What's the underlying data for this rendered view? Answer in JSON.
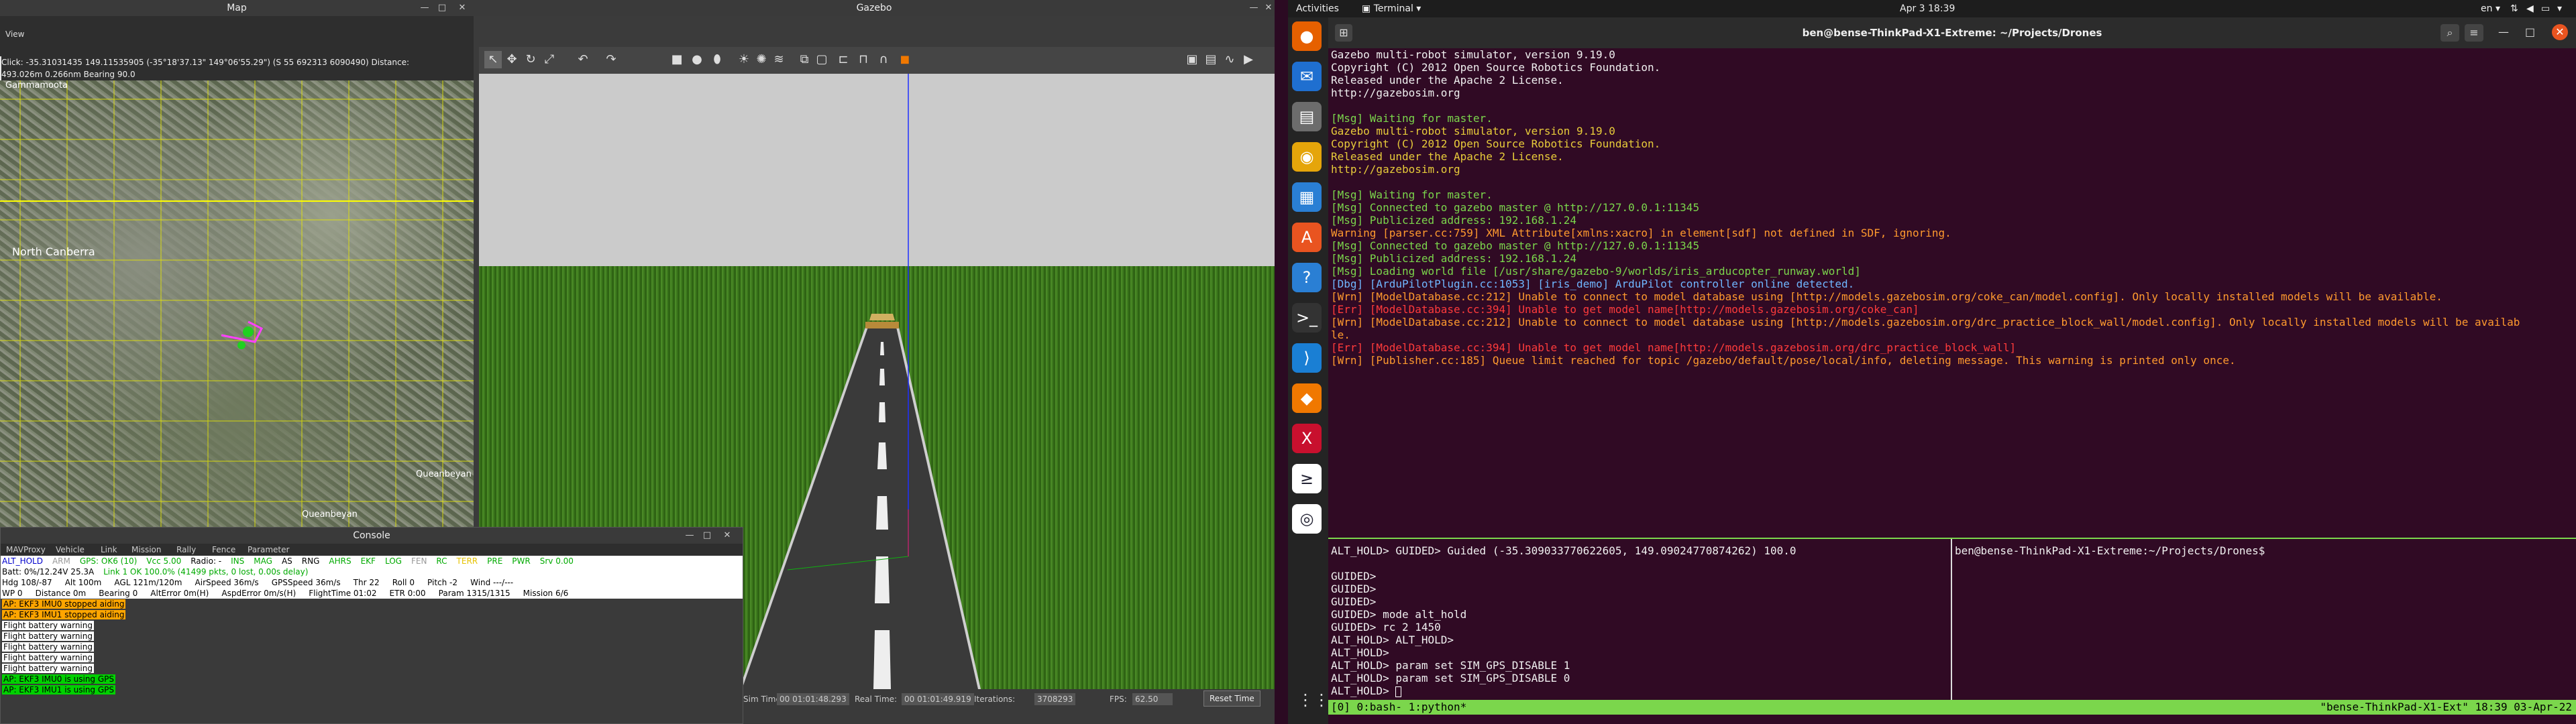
{
  "topbar": {
    "activities": "Activities",
    "app_menu": "Terminal",
    "clock": "Apr 3  18:39",
    "lang": "en"
  },
  "map": {
    "title": "Map",
    "menu_view": "View",
    "info_line1": "Click: -35.31031435 149.11535905 (-35°18'37.13\" 149°06'55.29\") (S 55 692313 6090490)  Distance:",
    "info_line2": "493.026m 0.266nm Bearing 90.0",
    "labels": [
      "Gammamoota",
      "North Canberra",
      "Queanbeyan",
      "Queanbeyan"
    ]
  },
  "console": {
    "title": "Console",
    "menu": [
      "MAVProxy",
      "Vehicle",
      "Link",
      "Mission",
      "Rally",
      "Fence",
      "Parameter"
    ],
    "status_row": [
      {
        "t": "ALT_HOLD",
        "c": "#0000cc"
      },
      {
        "t": "ARM",
        "c": "#999"
      },
      {
        "t": "GPS: OK6 (10)",
        "c": "#0a0"
      },
      {
        "t": "Vcc 5.00",
        "c": "#0a0"
      },
      {
        "t": "Radio: -",
        "c": "#000"
      },
      {
        "t": "INS",
        "c": "#0a0"
      },
      {
        "t": "MAG",
        "c": "#0a0"
      },
      {
        "t": "AS",
        "c": "#000"
      },
      {
        "t": "RNG",
        "c": "#000"
      },
      {
        "t": "AHRS",
        "c": "#0a0"
      },
      {
        "t": "EKF",
        "c": "#0a0"
      },
      {
        "t": "LOG",
        "c": "#0a0"
      },
      {
        "t": "FEN",
        "c": "#999"
      },
      {
        "t": "RC",
        "c": "#0a0"
      },
      {
        "t": "TERR",
        "c": "#e6c200"
      },
      {
        "t": "PRE",
        "c": "#0a0"
      },
      {
        "t": "PWR",
        "c": "#0a0"
      },
      {
        "t": "Srv 0.00",
        "c": "#0a0"
      }
    ],
    "batt": "Batt: 0%/12.24V 25.3A",
    "link": "Link 1 OK 100.0% (41499 pkts, 0 lost, 0.00s delay)",
    "row3": "Hdg 108/-87     Alt 100m     AGL 121m/120m     AirSpeed 36m/s     GPSSpeed 36m/s     Thr 22     Roll 0     Pitch -2     Wind ---/---",
    "row4": "WP 0     Distance 0m     Bearing 0     AltError 0m(H)     AspdError 0m/s(H)     FlightTime 01:02     ETR 0:00     Param 1315/1315     Mission 6/6",
    "messages": [
      {
        "t": "AP: EKF3 IMU0 stopped aiding",
        "bg": "#ffa500"
      },
      {
        "t": "AP: EKF3 IMU1 stopped aiding",
        "bg": "#ffa500"
      },
      {
        "t": "Flight battery warning",
        "bg": "#ffffff"
      },
      {
        "t": "Flight battery warning",
        "bg": "#ffffff"
      },
      {
        "t": "Flight battery warning",
        "bg": "#ffffff"
      },
      {
        "t": "Flight battery warning",
        "bg": "#ffffff"
      },
      {
        "t": "Flight battery warning",
        "bg": "#ffffff"
      },
      {
        "t": "AP: EKF3 IMU0 is using GPS",
        "bg": "#00d000"
      },
      {
        "t": "AP: EKF3 IMU1 is using GPS",
        "bg": "#00d000"
      }
    ]
  },
  "gazebo": {
    "title": "Gazebo",
    "sim_time_label": "Sim Time:",
    "sim_time": "00 01:01:48.293",
    "real_time_label": "Real Time:",
    "real_time": "00 01:01:49.919",
    "iter_label": "Iterations:",
    "iterations": "3708293",
    "fps_label": "FPS:",
    "fps": "62.50",
    "reset": "Reset Time"
  },
  "terminal": {
    "title": "ben@bense-ThinkPad-X1-Extreme: ~/Projects/Drones",
    "lines": [
      {
        "t": "Gazebo multi-robot simulator, version 9.19.0",
        "c": "w"
      },
      {
        "t": "Copyright (C) 2012 Open Source Robotics Foundation.",
        "c": "w"
      },
      {
        "t": "Released under the Apache 2 License.",
        "c": "w"
      },
      {
        "t": "http://gazebosim.org",
        "c": "w"
      },
      {
        "t": "",
        "c": "w"
      },
      {
        "t": "[Msg] Waiting for master.",
        "c": "g"
      },
      {
        "t": "Gazebo multi-robot simulator, version 9.19.0",
        "c": "y"
      },
      {
        "t": "Copyright (C) 2012 Open Source Robotics Foundation.",
        "c": "y"
      },
      {
        "t": "Released under the Apache 2 License.",
        "c": "y"
      },
      {
        "t": "http://gazebosim.org",
        "c": "y"
      },
      {
        "t": "",
        "c": "w"
      },
      {
        "t": "[Msg] Waiting for master.",
        "c": "g"
      },
      {
        "t": "[Msg] Connected to gazebo master @ http://127.0.0.1:11345",
        "c": "g"
      },
      {
        "t": "[Msg] Publicized address: 192.168.1.24",
        "c": "g"
      },
      {
        "t": "Warning [parser.cc:759] XML Attribute[xmlns:xacro] in element[sdf] not defined in SDF, ignoring.",
        "c": "o"
      },
      {
        "t": "[Msg] Connected to gazebo master @ http://127.0.0.1:11345",
        "c": "g"
      },
      {
        "t": "[Msg] Publicized address: 192.168.1.24",
        "c": "g"
      },
      {
        "t": "[Msg] Loading world file [/usr/share/gazebo-9/worlds/iris_arducopter_runway.world]",
        "c": "g"
      },
      {
        "t": "[Dbg] [ArduPilotPlugin.cc:1053] [iris_demo] ArduPilot controller online detected.",
        "c": "b"
      },
      {
        "t": "[Wrn] [ModelDatabase.cc:212] Unable to connect to model database using [http://models.gazebosim.org/coke_can/model.config]. Only locally installed models will be available.",
        "c": "o"
      },
      {
        "t": "[Err] [ModelDatabase.cc:394] Unable to get model name[http://models.gazebosim.org/coke_can]",
        "c": "r"
      },
      {
        "t": "[Wrn] [ModelDatabase.cc:212] Unable to connect to model database using [http://models.gazebosim.org/drc_practice_block_wall/model.config]. Only locally installed models will be availab",
        "c": "o"
      },
      {
        "t": "le.",
        "c": "o"
      },
      {
        "t": "[Err] [ModelDatabase.cc:394] Unable to get model name[http://models.gazebosim.org/drc_practice_block_wall]",
        "c": "r"
      },
      {
        "t": "[Wrn] [Publisher.cc:185] Queue limit reached for topic /gazebo/default/pose/local/info, deleting message. This warning is printed only once.",
        "c": "o"
      }
    ],
    "pane2_lines": [
      "ALT_HOLD> GUIDED> Guided (-35.309033770622605, 149.09024770874262) 100.0",
      "",
      "GUIDED>",
      "GUIDED>",
      "GUIDED>",
      "GUIDED> mode alt_hold",
      "GUIDED> rc 2 1450",
      "ALT_HOLD> ALT_HOLD>",
      "ALT_HOLD>",
      "ALT_HOLD> param set SIM_GPS_DISABLE 1",
      "ALT_HOLD> param set SIM_GPS_DISABLE 0",
      "ALT_HOLD> "
    ],
    "pane3_prompt": "ben@bense-ThinkPad-X1-Extreme:~/Projects/Drones$",
    "status_left": "[0] 0:bash- 1:python*",
    "status_right": "\"bense-ThinkPad-X1-Ext\" 18:39 03-Apr-22"
  },
  "dock": [
    {
      "name": "firefox-icon",
      "glyph": "●",
      "bg": "#e66000"
    },
    {
      "name": "thunderbird-icon",
      "glyph": "✉",
      "bg": "#1f6fd0"
    },
    {
      "name": "files-icon",
      "glyph": "▤",
      "bg": "#6c6c6c"
    },
    {
      "name": "rhythmbox-icon",
      "glyph": "◉",
      "bg": "#e5a50a"
    },
    {
      "name": "libreoffice-writer-icon",
      "glyph": "▦",
      "bg": "#2a7fd4"
    },
    {
      "name": "software-center-icon",
      "glyph": "A",
      "bg": "#e95420"
    },
    {
      "name": "help-icon",
      "glyph": "?",
      "bg": "#2a7fd4"
    },
    {
      "name": "terminal-icon",
      "glyph": ">_",
      "bg": "#333"
    },
    {
      "name": "vscode-icon",
      "glyph": "⟩",
      "bg": "#1a7fd4"
    },
    {
      "name": "layers-icon",
      "glyph": "◆",
      "bg": "#f07800"
    },
    {
      "name": "xmind-icon",
      "glyph": "X",
      "bg": "#c8102e"
    },
    {
      "name": "powershell-icon",
      "glyph": "≥",
      "bg": "#ffffff"
    },
    {
      "name": "qgroundcontrol-icon",
      "glyph": "◎",
      "bg": "#ffffff"
    }
  ]
}
